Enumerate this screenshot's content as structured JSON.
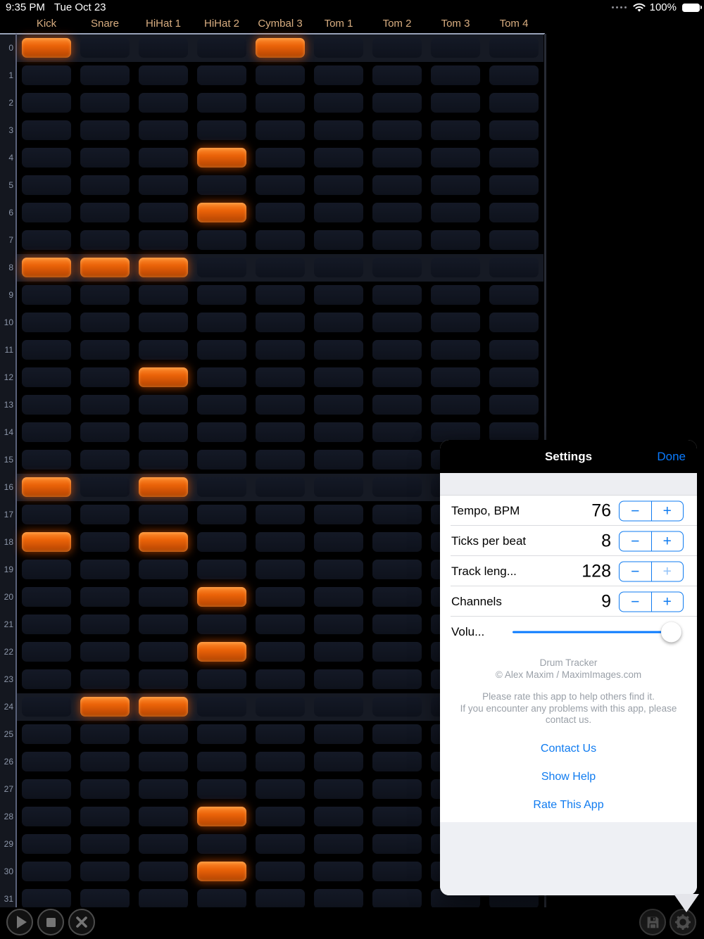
{
  "status_bar": {
    "time": "9:35 PM",
    "date": "Tue Oct 23",
    "battery_percent": "100%",
    "icons": [
      "cellular-signal-icon",
      "wifi-icon",
      "battery-icon"
    ]
  },
  "track_grid": {
    "columns": [
      "Kick",
      "Snare",
      "HiHat 1",
      "HiHat 2",
      "Cymbal 3",
      "Tom 1",
      "Tom 2",
      "Tom 3",
      "Tom 4"
    ],
    "row_count": 32,
    "rows_per_beat": 8,
    "active_cells": [
      [
        0,
        0
      ],
      [
        0,
        4
      ],
      [
        4,
        3
      ],
      [
        6,
        3
      ],
      [
        8,
        0
      ],
      [
        8,
        1
      ],
      [
        8,
        2
      ],
      [
        12,
        2
      ],
      [
        16,
        0
      ],
      [
        16,
        2
      ],
      [
        18,
        0
      ],
      [
        18,
        2
      ],
      [
        20,
        3
      ],
      [
        22,
        3
      ],
      [
        24,
        1
      ],
      [
        24,
        2
      ],
      [
        28,
        3
      ],
      [
        30,
        3
      ]
    ]
  },
  "settings": {
    "title": "Settings",
    "done_label": "Done",
    "rows": [
      {
        "label": "Tempo, BPM",
        "value": "76",
        "type": "stepper"
      },
      {
        "label": "Ticks per beat",
        "value": "8",
        "type": "stepper"
      },
      {
        "label": "Track leng...",
        "value": "128",
        "type": "stepper",
        "plus_disabled": true
      },
      {
        "label": "Channels",
        "value": "9",
        "type": "stepper"
      },
      {
        "label": "Volu...",
        "type": "slider",
        "value": 100
      }
    ],
    "about_line1": "Drum Tracker",
    "about_line2": "© Alex Maxim / MaximImages.com",
    "note_line1": "Please rate this app to help others find it.",
    "note_line2": "If you encounter any problems with this app, please contact us.",
    "links": [
      "Contact Us",
      "Show Help",
      "Rate This App"
    ]
  },
  "toolbar": {
    "buttons": [
      "play",
      "stop",
      "close",
      "save",
      "settings"
    ]
  },
  "colors": {
    "accent_blue": "#0a7bff",
    "active_cell_orange": "#ea6208",
    "header_tan": "#d9ae81",
    "cell_dark": "#10151f",
    "background": "#000000"
  }
}
